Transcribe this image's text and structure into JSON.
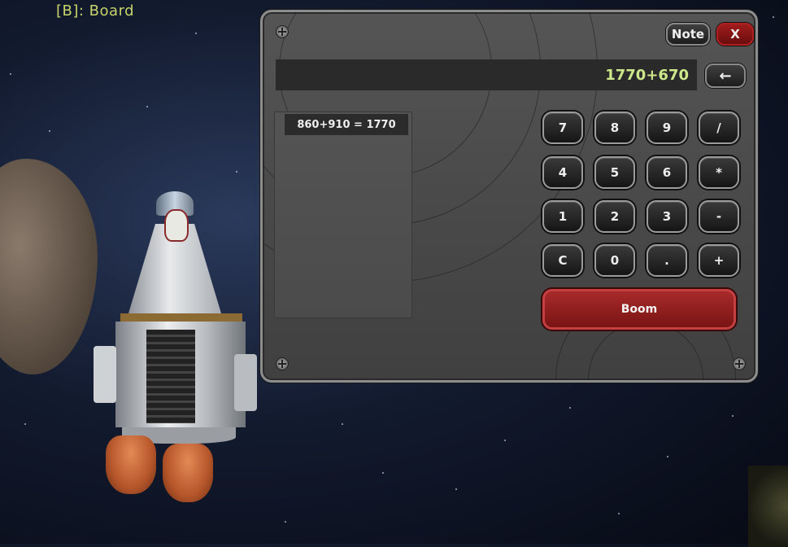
{
  "hud": {
    "board_hint": "[B]: Board"
  },
  "window": {
    "note_label": "Note",
    "close_label": "X",
    "display_value": "1770+670",
    "back_label": "←",
    "history": [
      "860+910 = 1770"
    ],
    "keys": [
      [
        "7",
        "8",
        "9",
        "/"
      ],
      [
        "4",
        "5",
        "6",
        "*"
      ],
      [
        "1",
        "2",
        "3",
        "-"
      ],
      [
        "C",
        "0",
        ".",
        "+"
      ]
    ],
    "boom_label": "Boom"
  },
  "colors": {
    "display_text": "#cde88a",
    "close_button": "#a01c1c",
    "boom_button": "#a82a2a",
    "hint_text": "#c7d46a"
  }
}
